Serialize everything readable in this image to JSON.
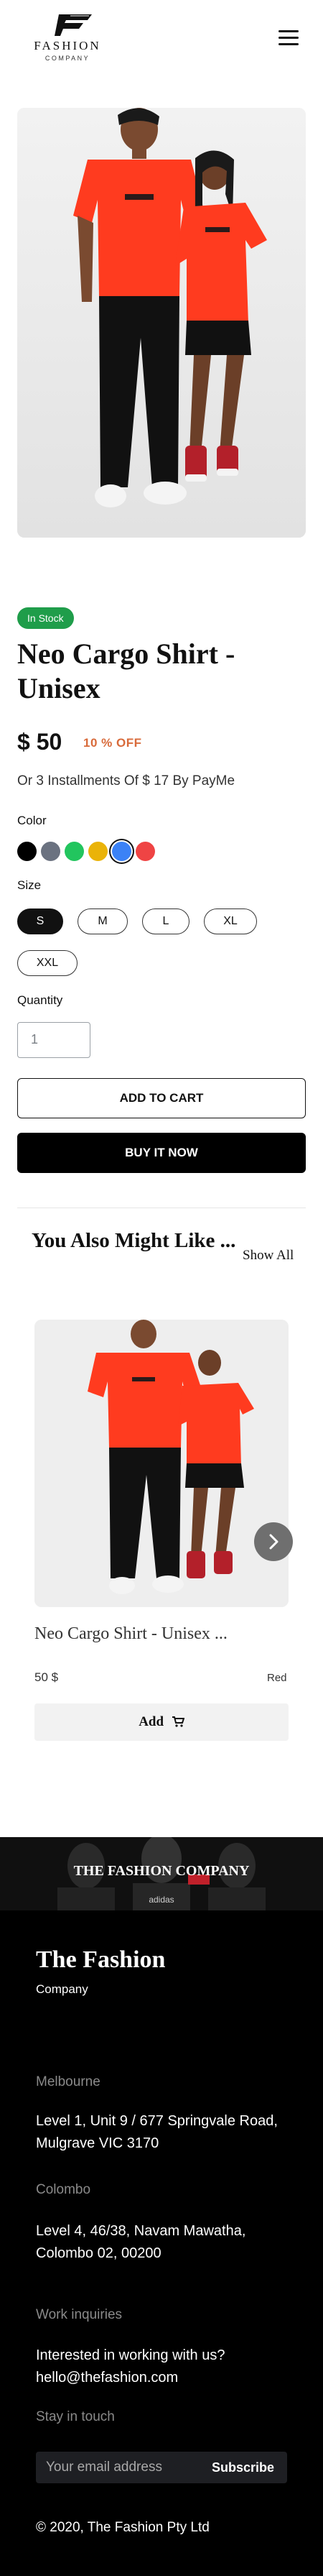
{
  "header": {
    "logo_text": "FASHION",
    "logo_sub": "COMPANY"
  },
  "product": {
    "stock": "In Stock",
    "title": "Neo Cargo Shirt - Unisex",
    "price": "$ 50",
    "discount": "10 % OFF",
    "installments": "Or 3 Installments Of $ 17 By PayMe",
    "color_label": "Color",
    "colors": [
      "#000000",
      "#6b7280",
      "#22c55e",
      "#eab308",
      "#3b82f6",
      "#ef4444"
    ],
    "selected_color": "#3b82f6",
    "size_label": "Size",
    "sizes": [
      "S",
      "M",
      "L",
      "XL",
      "XXL"
    ],
    "selected_size": "S",
    "quantity_label": "Quantity",
    "quantity_value": "1",
    "add_to_cart": "ADD TO CART",
    "buy_now": "BUY IT NOW"
  },
  "related": {
    "title": "You Also Might Like ...",
    "show_all": "Show All",
    "item": {
      "name": "Neo Cargo Shirt - Unisex ...",
      "price": "50 $",
      "color": "Red",
      "add_label": "Add"
    }
  },
  "footer": {
    "banner_text": "THE FASHION COMPANY",
    "banner_small": "adidas",
    "brand": "The Fashion",
    "company": "Company",
    "melbourne_head": "Melbourne",
    "melbourne_addr": "Level 1, Unit 9 / 677 Springvale Road, Mulgrave VIC 3170",
    "colombo_head": "Colombo",
    "colombo_addr": "Level 4, 46/38, Navam Mawatha, Colombo 02, 00200",
    "work_head": "Work inquiries",
    "work_text": "Interested in working with us?",
    "work_email": "hello@thefashion.com",
    "touch_head": "Stay in touch",
    "email_placeholder": "Your email address",
    "subscribe": "Subscribe",
    "copyright": "© 2020, The Fashion Pty Ltd"
  },
  "colors": {
    "accent_green": "#1f9d4a",
    "discount_orange": "#d86a3a",
    "shirt_red": "#ff3b1f"
  }
}
